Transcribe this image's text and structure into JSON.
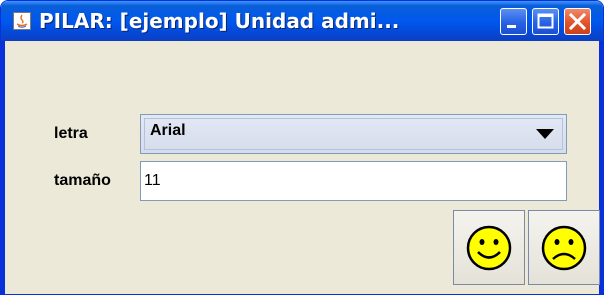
{
  "window": {
    "title": "PILAR: [ejemplo] Unidad admi...",
    "titlebar_color": "#0058ee",
    "controls": [
      "minimize-icon",
      "maximize-icon",
      "close-icon"
    ]
  },
  "form": {
    "font_label": "letra",
    "font_value": "Arial",
    "size_label": "tamaño",
    "size_value": "11"
  },
  "buttons": {
    "accept_icon": "happy-face-icon",
    "cancel_icon": "sad-face-icon",
    "face_color": "#ffff00"
  }
}
